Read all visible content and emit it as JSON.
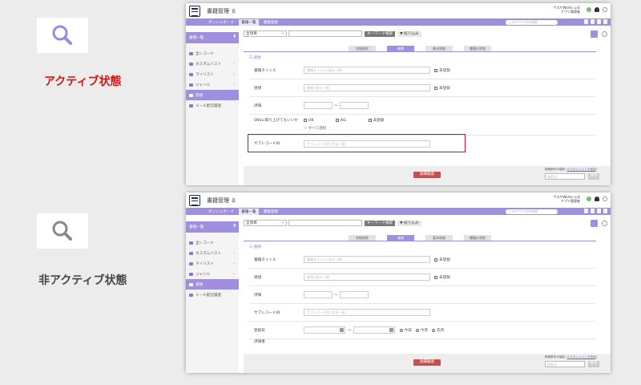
{
  "states": [
    {
      "label": "アクティブ状態",
      "label_color": "#e01010",
      "icon_color": "#9b87e6"
    },
    {
      "label": "非アクティブ状態",
      "label_color": "#444444",
      "icon_color": "#888888"
    }
  ],
  "app": {
    "title": "書籍管理",
    "title_pin": "頁",
    "org_line1": "サスケWorks 公式",
    "org_line2": "アプリ管理者",
    "nav_dashboard": "ダッシュボード",
    "nav_list": "書籍一覧",
    "nav_register": "書籍登録",
    "search_placeholder": "このアプリ内を検索"
  },
  "sidebar": {
    "header": "書籍一覧",
    "items": [
      {
        "label": "全レコード",
        "chevron": false
      },
      {
        "label": "カスタムリスト",
        "chevron": true
      },
      {
        "label": "マイリスト",
        "chevron": true
      },
      {
        "label": "ジャンル",
        "chevron": true
      },
      {
        "label": "感想",
        "chevron": false
      },
      {
        "label": "メール配信履歴",
        "chevron": false
      }
    ]
  },
  "toolbar": {
    "select_value": "全項目",
    "keyword_button": "キーワード検索",
    "filter_button": "絞り込み"
  },
  "tabs": [
    "詳細検索",
    "感想",
    "基本情報",
    "書籍の状態"
  ],
  "section_title": "感想",
  "form_active": {
    "title_label": "書籍タイトル",
    "title_placeholder": "書籍タイトル (部分一致)",
    "unregistered": "未登録",
    "review_label": "感想",
    "review_placeholder": "感想 (部分一致)",
    "rating_label": "評価",
    "range_sep": "〜",
    "sns_label": "SNSに取り上げてもいいか",
    "sns_ok": "OK",
    "sns_ng": "NG",
    "select_all": "すべて選択",
    "sub_label": "サブレコードID",
    "sub_placeholder": "サブレコードID (完全一致)"
  },
  "form_inactive": {
    "date_label": "登録日",
    "today": "今日",
    "this_month": "今月",
    "last_month": "先月",
    "partial_label": "評価者"
  },
  "footer": {
    "detail_button": "詳細検索",
    "note_prefix": "検索条件の保存 (",
    "note_link": "カスタムリストを使用",
    "note_suffix": ")",
    "name_placeholder": "検索名",
    "save_button": "保存"
  }
}
